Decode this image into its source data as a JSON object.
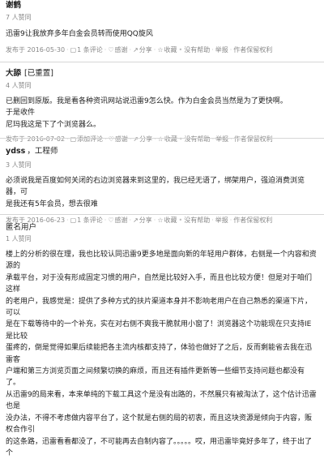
{
  "answers": [
    {
      "name": "谢鹤",
      "title": "",
      "votes": "7 人赞同",
      "body": [
        "迅雷9让我放弃多年白金会员转而使用QQ旋风"
      ],
      "date": "发布于 2016-05-30",
      "comments": "1 条评论",
      "thanks": "感谢",
      "share": "分享",
      "collect": "收藏",
      "dot": "•",
      "no_help": "没有帮助",
      "report": "举报",
      "copyright": "作者保留权利"
    },
    {
      "name": "大舔",
      "title": "[已重置]",
      "votes": "4 人赞同",
      "body": [
        "已删回到原版。我是看各种资讯网站说迅雷9怎么快。作为白金会员当然是为了更快啊。",
        "于是收件",
        "尼玛我这是下了个浏览器么。"
      ],
      "date": "发布于 2016-07-02",
      "comments": "添加评论",
      "thanks": "感谢",
      "share": "分享",
      "collect": "收藏",
      "dot": "•",
      "no_help": "没有帮助",
      "report": "举报",
      "copyright": "作者保留权利"
    },
    {
      "name": "ydss",
      "title": "，工程师",
      "votes": "3 人赞同",
      "body": [
        "必须说我是百度如何关闭的右边浏览器来到这里的，我已经无语了，绑架用户，强迫消费浏览器，可",
        "是我还有5年会员，想去很难"
      ],
      "date": "发布于 2016-06-23",
      "comments": "1 条评论",
      "thanks": "感谢",
      "share": "分享",
      "collect": "收藏",
      "dot": "•",
      "no_help": "没有帮助",
      "report": "举报",
      "copyright": "作者保留权利"
    },
    {
      "name": "匿名用户",
      "title": "",
      "votes": "1 人赞同",
      "body": [
        "楼上的分析的很在理，我也比较认同迅雷9更多地是面向新的年轻用户群体，右侧是一个内容和资源的",
        "承载平台，对于没有形成固定习惯的用户，自然是比较好入手，而且也比较方便！但是对于咱们这样",
        "的老用户，我感觉是：提供了多种方式的扶片渠道本身并不影响老用户在自己熟悉的渠道下片，可以",
        "是在下载等待中的一个补充，实在对右侧不爽我干脆就用小窗了！浏览器这个功能现在只支持IE是比较",
        "蛋疼的，倒是觉得如果后续能把各主流内核都支持了，体验也做好了之后，反而剩能省去我在迅雷客",
        "户端和第三方浏览页面之间频繁切换的麻烦，而且还有插件更新等一些细节支持问题也都没有了。",
        "从迅雷9的局来看，本来单纯的下载工具这个是没有出路的，不然展只有被淘汰了，这个估计迅雷也是",
        "没办法，不得不考虑做内容平台了，这个就是右侧的局的初衷，而且这块资源是倾向于内容，贩权合作引",
        "的这条路，迅雷看看都没了，不可能再去自制内容了。。。。。哎，用迅雷毕竟好多年了，终于出了个"
      ]
    }
  ]
}
